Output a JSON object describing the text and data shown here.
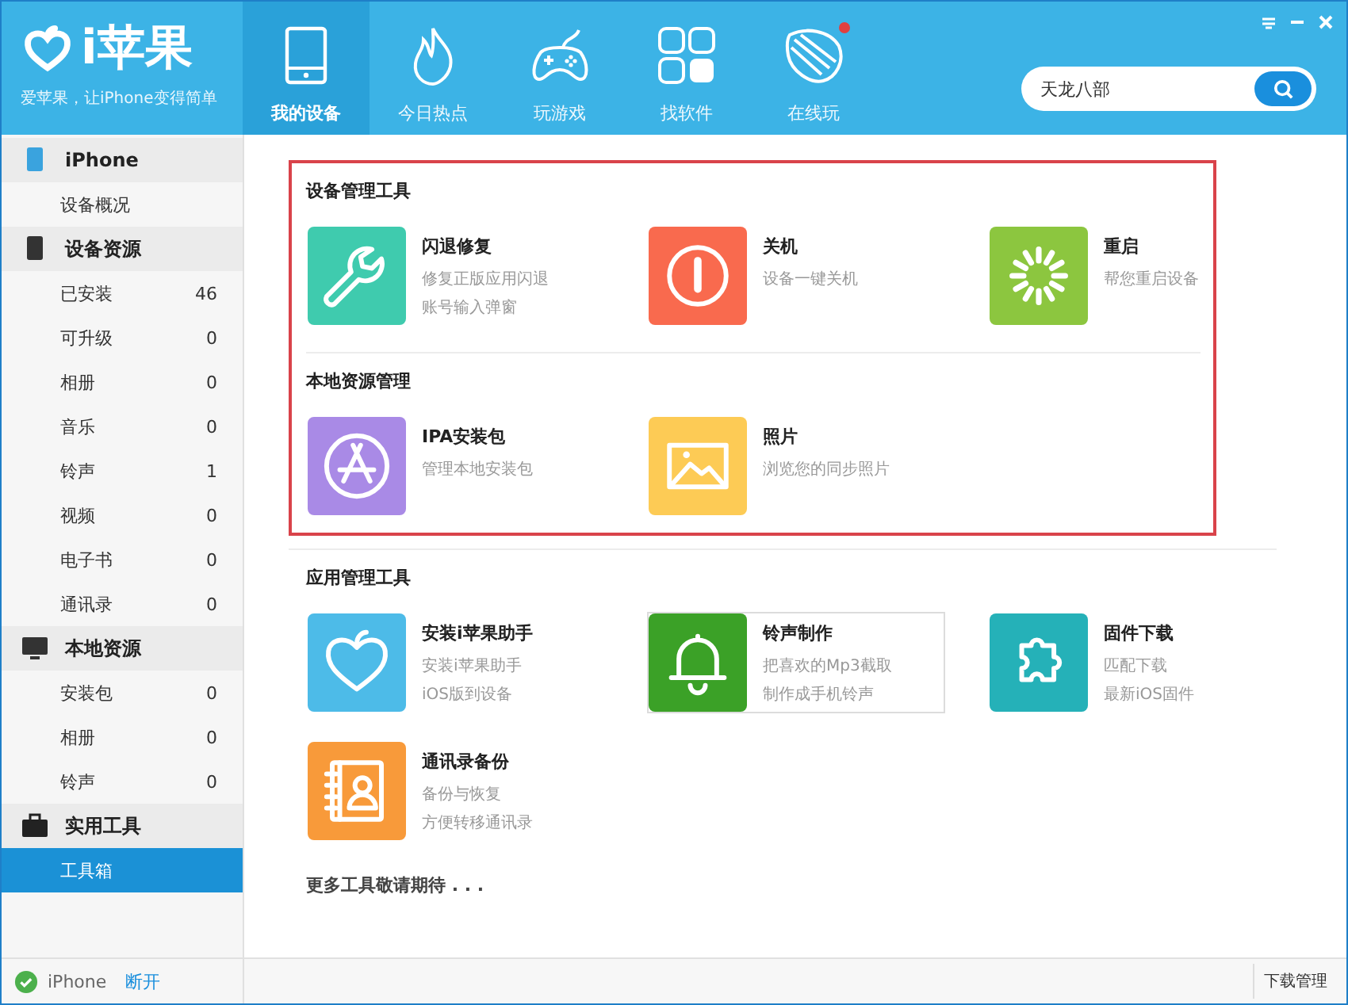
{
  "header": {
    "logo_text": "i苹果",
    "slogan": "爱苹果，让iPhone变得简单",
    "tabs": [
      {
        "label": "我的设备",
        "selected": true,
        "badge": false
      },
      {
        "label": "今日热点",
        "selected": false,
        "badge": false
      },
      {
        "label": "玩游戏",
        "selected": false,
        "badge": false
      },
      {
        "label": "找软件",
        "selected": false,
        "badge": false
      },
      {
        "label": "在线玩",
        "selected": false,
        "badge": true
      }
    ],
    "search": {
      "value": "天龙八部"
    }
  },
  "sidebar": {
    "groups": [
      {
        "label": "iPhone",
        "items": [
          {
            "label": "设备概况",
            "selected": false
          }
        ]
      },
      {
        "label": "设备资源",
        "items": [
          {
            "label": "已安装",
            "count": "46",
            "selected": false
          },
          {
            "label": "可升级",
            "count": "0",
            "selected": false
          },
          {
            "label": "相册",
            "count": "0",
            "selected": false
          },
          {
            "label": "音乐",
            "count": "0",
            "selected": false
          },
          {
            "label": "铃声",
            "count": "1",
            "selected": false
          },
          {
            "label": "视频",
            "count": "0",
            "selected": false
          },
          {
            "label": "电子书",
            "count": "0",
            "selected": false
          },
          {
            "label": "通讯录",
            "count": "0",
            "selected": false
          }
        ]
      },
      {
        "label": "本地资源",
        "items": [
          {
            "label": "安装包",
            "count": "0",
            "selected": false
          },
          {
            "label": "相册",
            "count": "0",
            "selected": false
          },
          {
            "label": "铃声",
            "count": "0",
            "selected": false
          }
        ]
      },
      {
        "label": "实用工具",
        "items": [
          {
            "label": "工具箱",
            "selected": true
          }
        ]
      }
    ],
    "status": {
      "device": "iPhone",
      "connected": true,
      "action": "断开"
    }
  },
  "content": {
    "groups": [
      {
        "highlighted": true,
        "sections": [
          {
            "title": "设备管理工具",
            "tools": [
              {
                "title": "闪退修复",
                "lines": [
                  "修复正版应用闪退",
                  "账号输入弹窗"
                ],
                "color": "#3fcbae",
                "hovered": false
              },
              {
                "title": "关机",
                "lines": [
                  "设备一键关机"
                ],
                "color": "#f96a4e",
                "hovered": false
              },
              {
                "title": "重启",
                "lines": [
                  "帮您重启设备"
                ],
                "color": "#8cc63f",
                "hovered": false
              }
            ]
          },
          {
            "title": "本地资源管理",
            "tools": [
              {
                "title": "IPA安装包",
                "lines": [
                  "管理本地安装包"
                ],
                "color": "#a98ae6",
                "hovered": false
              },
              {
                "title": "照片",
                "lines": [
                  "浏览您的同步照片"
                ],
                "color": "#fdcb55",
                "hovered": false
              }
            ]
          }
        ]
      },
      {
        "highlighted": false,
        "sections": [
          {
            "title": "应用管理工具",
            "tools": [
              {
                "title": "安装i苹果助手",
                "lines": [
                  "安装i苹果助手",
                  "iOS版到设备"
                ],
                "color": "#4dbbe8",
                "hovered": false
              },
              {
                "title": "铃声制作",
                "lines": [
                  "把喜欢的Mp3截取",
                  "制作成手机铃声"
                ],
                "color": "#3ba127",
                "hovered": true
              },
              {
                "title": "固件下载",
                "lines": [
                  "匹配下载",
                  "最新iOS固件"
                ],
                "color": "#25b1b8",
                "hovered": false
              },
              {
                "title": "通讯录备份",
                "lines": [
                  "备份与恢复",
                  "方便转移通讯录"
                ],
                "color": "#f89a3a",
                "hovered": false
              }
            ]
          }
        ]
      }
    ],
    "more_note": "更多工具敬请期待 . . .",
    "download_manager": "下载管理"
  }
}
